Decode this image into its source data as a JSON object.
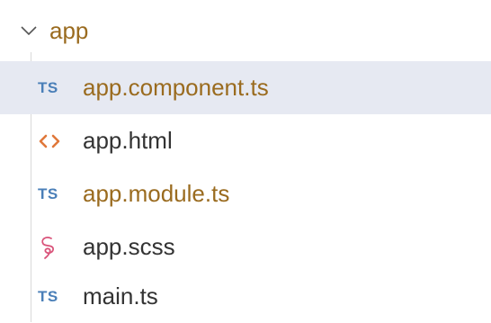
{
  "folder": {
    "label": "app",
    "expanded": true,
    "label_color": "#9a6b1f"
  },
  "files": [
    {
      "label": "app.component.ts",
      "icon": "typescript-icon",
      "icon_text": "TS",
      "icon_color": "#4a7fb8",
      "label_color": "#9a6b1f",
      "selected": true
    },
    {
      "label": "app.html",
      "icon": "html-icon",
      "icon_color": "#e0783a",
      "label_color": "#333333",
      "selected": false
    },
    {
      "label": "app.module.ts",
      "icon": "typescript-icon",
      "icon_text": "TS",
      "icon_color": "#4a7fb8",
      "label_color": "#9a6b1f",
      "selected": false
    },
    {
      "label": "app.scss",
      "icon": "sass-icon",
      "icon_color": "#d9537a",
      "label_color": "#333333",
      "selected": false
    },
    {
      "label": "main.ts",
      "icon": "typescript-icon",
      "icon_text": "TS",
      "icon_color": "#4a7fb8",
      "label_color": "#333333",
      "selected": false
    }
  ],
  "colors": {
    "selection_background": "#e6e9f2",
    "tree_guide": "#d9d9d9"
  }
}
